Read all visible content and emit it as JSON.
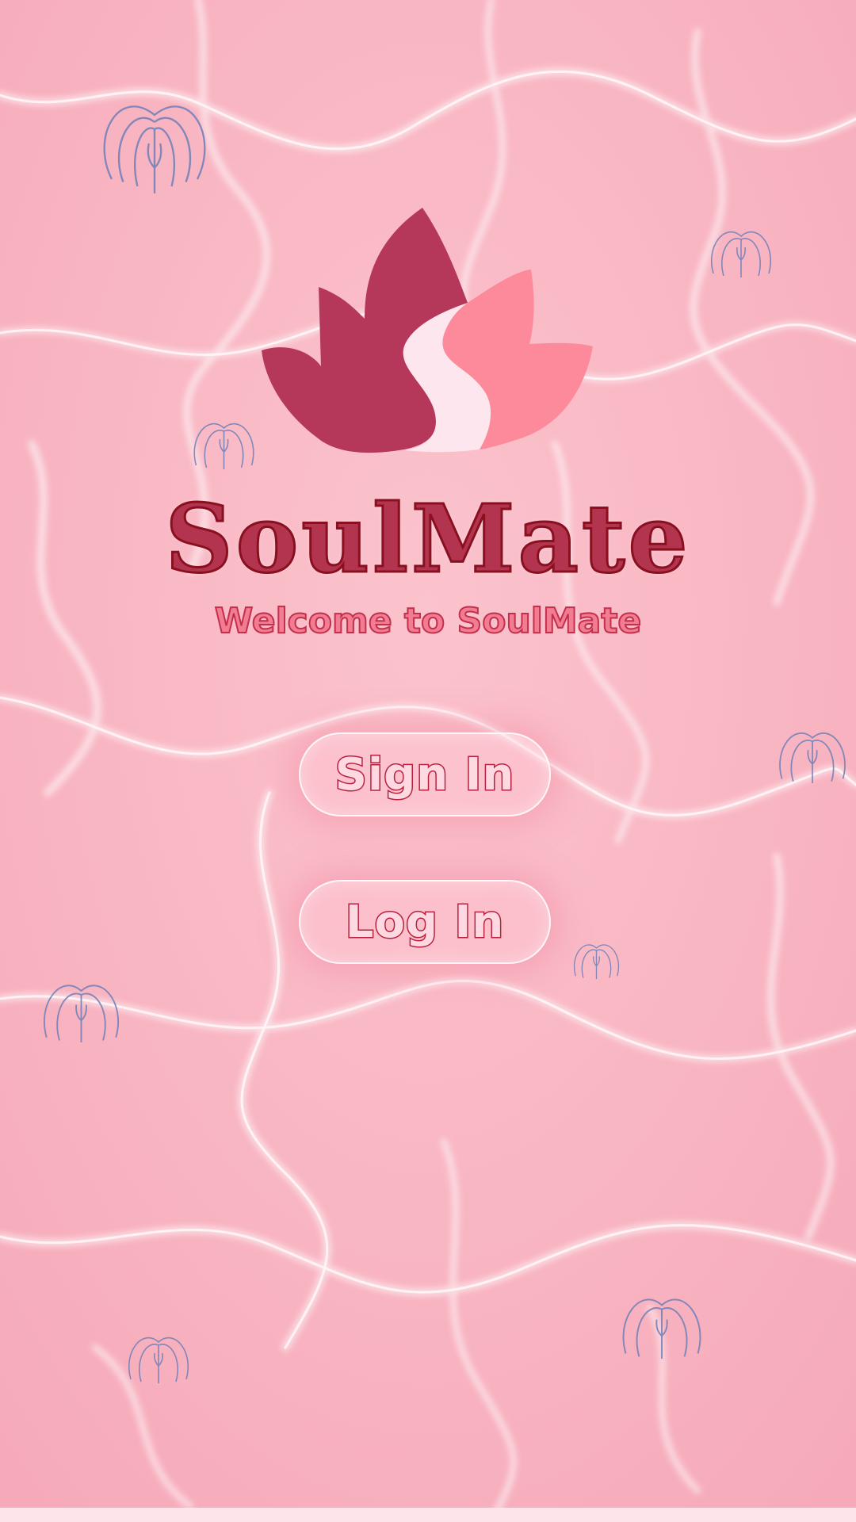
{
  "app": {
    "name": "SoulMate",
    "welcome": "Welcome to SoulMate"
  },
  "buttons": {
    "sign_in": "Sign In",
    "log_in": "Log In"
  },
  "colors": {
    "background": "#f9b8c4",
    "logo_dark_petal": "#b5375a",
    "logo_light_petal": "#fc8a9a",
    "logo_river": "#fde6ee",
    "title": "#b2344f",
    "button_text_outline": "#b8203e",
    "jellyfish": "#6e7fb8"
  },
  "icons": {
    "logo": "lotus-river-logo",
    "decor": "jellyfish-icon"
  }
}
